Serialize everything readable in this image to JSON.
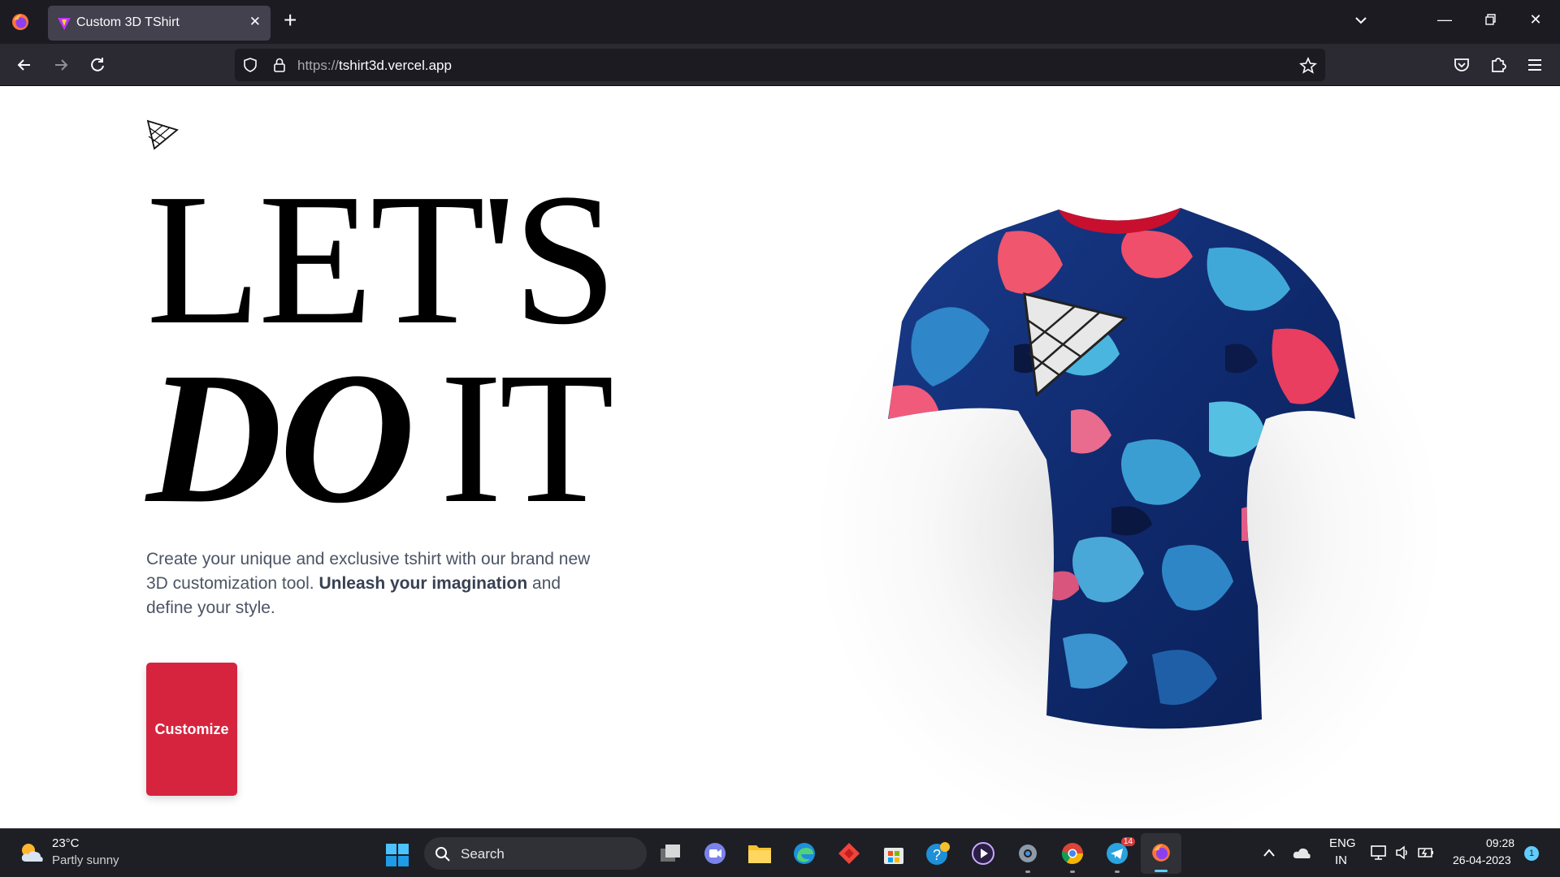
{
  "browser": {
    "tab_title": "Custom 3D TShirt",
    "url_scheme": "https://",
    "url_host": "tshirt3d.vercel.app"
  },
  "page": {
    "headline_line1": "LET'S",
    "headline_do": "DO",
    "headline_it": "IT",
    "intro_text_1": "Create your unique and exclusive tshirt with our brand new 3D customization tool.",
    "intro_bold": "Unleash your imagination",
    "intro_text_2": "and define your style.",
    "customize_label": "Customize",
    "accent_color": "#d6243f"
  },
  "taskbar": {
    "weather_temp": "23°C",
    "weather_desc": "Partly sunny",
    "search_label": "Search",
    "lang_line1": "ENG",
    "lang_line2": "IN",
    "time": "09:28",
    "date": "26-04-2023",
    "telegram_badge": "14",
    "notification_count": "1"
  }
}
